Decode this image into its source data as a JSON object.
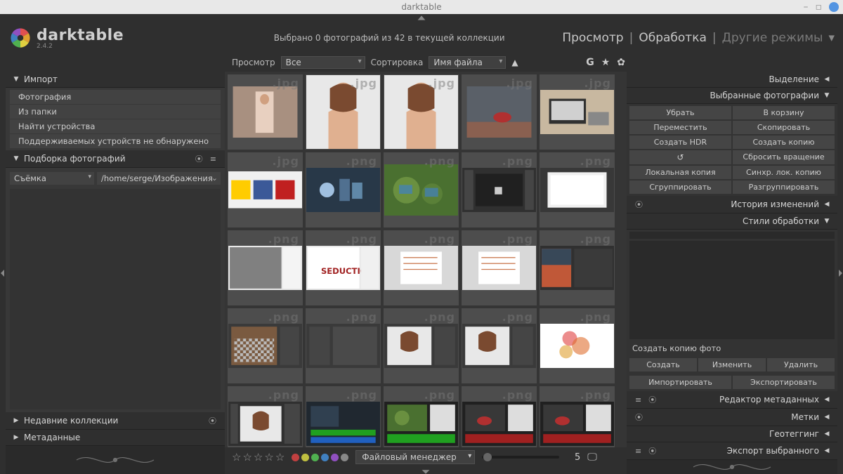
{
  "window": {
    "title": "darktable"
  },
  "app": {
    "name": "darktable",
    "version": "2.4.2"
  },
  "status": "Выбрано 0 фотографий из 42 в текущей коллекции",
  "views": {
    "view": "Просмотр",
    "darkroom": "Обработка",
    "other": "Другие режимы"
  },
  "filter": {
    "view_label": "Просмотр",
    "view_value": "Все",
    "sort_label": "Сортировка",
    "sort_value": "Имя файла"
  },
  "left": {
    "import": {
      "title": "Импорт",
      "items": [
        "Фотография",
        "Из папки",
        "Найти устройства",
        "Поддерживаемых устройств не обнаружено"
      ]
    },
    "collect": {
      "title": "Подборка фотографий",
      "rule_type": "Съёмка",
      "rule_path": "/home/serge/Изображения"
    },
    "recent": {
      "title": "Недавние коллекции"
    },
    "metadata": {
      "title": "Метаданные"
    }
  },
  "right": {
    "select": {
      "title": "Выделение"
    },
    "selected": {
      "title": "Выбранные фотографии",
      "buttons": [
        "Убрать",
        "В корзину",
        "Переместить",
        "Скопировать",
        "Создать HDR",
        "Создать копию",
        "↺",
        "Сбросить вращение",
        "Локальная копия",
        "Синхр. лок. копию",
        "Сгруппировать",
        "Разгруппировать"
      ]
    },
    "history": {
      "title": "История изменений"
    },
    "styles": {
      "title": "Стили обработки",
      "create_copy": "Создать копию фото",
      "buttons": [
        "Создать",
        "Изменить",
        "Удалить",
        "Импортировать",
        "Экспортировать"
      ]
    },
    "meta_editor": {
      "title": "Редактор метаданных"
    },
    "tags": {
      "title": "Метки"
    },
    "geo": {
      "title": "Геотеггинг"
    },
    "export": {
      "title": "Экспорт выбранного"
    }
  },
  "bottom": {
    "target": "Файловый менеджер",
    "columns": "5"
  },
  "thumb_ext": {
    "jpg": ".jpg",
    "png": ".png"
  },
  "colors": {
    "dots": [
      "#c04040",
      "#c0c040",
      "#50b050",
      "#4080c0",
      "#9050c0",
      "#888888"
    ]
  }
}
